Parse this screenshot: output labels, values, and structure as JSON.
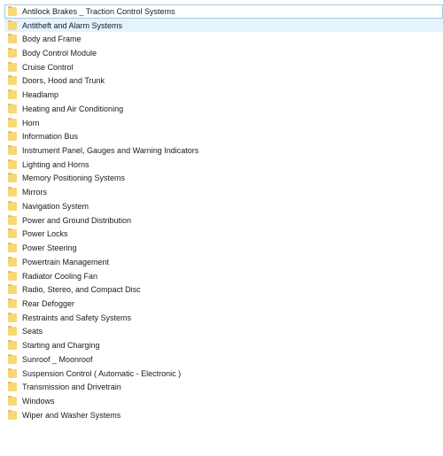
{
  "list": {
    "focused_index": 0,
    "hover_index": 1,
    "items": [
      {
        "label": "Antilock Brakes _ Traction Control Systems",
        "icon": "folder-icon"
      },
      {
        "label": "Antitheft and Alarm Systems",
        "icon": "folder-icon"
      },
      {
        "label": "Body and Frame",
        "icon": "folder-icon"
      },
      {
        "label": "Body Control Module",
        "icon": "folder-icon"
      },
      {
        "label": "Cruise Control",
        "icon": "folder-icon"
      },
      {
        "label": "Doors, Hood and Trunk",
        "icon": "folder-icon"
      },
      {
        "label": "Headlamp",
        "icon": "folder-icon"
      },
      {
        "label": "Heating and Air Conditioning",
        "icon": "folder-icon"
      },
      {
        "label": "Horn",
        "icon": "folder-icon"
      },
      {
        "label": "Information Bus",
        "icon": "folder-icon"
      },
      {
        "label": "Instrument Panel, Gauges and Warning Indicators",
        "icon": "folder-icon"
      },
      {
        "label": "Lighting and Horns",
        "icon": "folder-icon"
      },
      {
        "label": "Memory Positioning Systems",
        "icon": "folder-icon"
      },
      {
        "label": "Mirrors",
        "icon": "folder-icon"
      },
      {
        "label": "Navigation System",
        "icon": "folder-icon"
      },
      {
        "label": "Power and Ground Distribution",
        "icon": "folder-icon"
      },
      {
        "label": "Power Locks",
        "icon": "folder-icon"
      },
      {
        "label": "Power Steering",
        "icon": "folder-icon"
      },
      {
        "label": "Powertrain Management",
        "icon": "folder-icon"
      },
      {
        "label": "Radiator Cooling Fan",
        "icon": "folder-icon"
      },
      {
        "label": "Radio, Stereo, and Compact Disc",
        "icon": "folder-icon"
      },
      {
        "label": "Rear Defogger",
        "icon": "folder-icon"
      },
      {
        "label": "Restraints and Safety Systems",
        "icon": "folder-icon"
      },
      {
        "label": "Seats",
        "icon": "folder-icon"
      },
      {
        "label": "Starting and Charging",
        "icon": "folder-icon"
      },
      {
        "label": "Sunroof _ Moonroof",
        "icon": "folder-icon"
      },
      {
        "label": "Suspension Control ( Automatic - Electronic )",
        "icon": "folder-icon"
      },
      {
        "label": "Transmission and Drivetrain",
        "icon": "folder-icon"
      },
      {
        "label": "Windows",
        "icon": "folder-icon"
      },
      {
        "label": "Wiper and Washer Systems",
        "icon": "folder-icon"
      }
    ]
  },
  "colors": {
    "folder": "#f8d775",
    "hover": "#e5f3ff",
    "focus_border": "#a9c8dc"
  }
}
